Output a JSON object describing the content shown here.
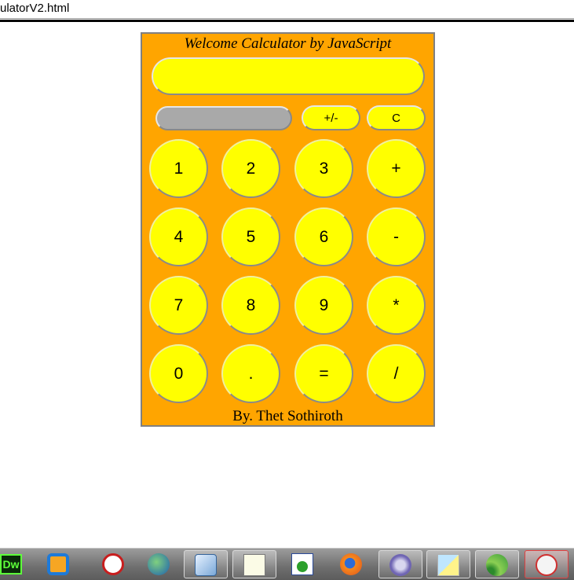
{
  "window": {
    "title": "ulatorV2.html"
  },
  "calculator": {
    "heading": "Welcome Calculator by JavaScript",
    "display_value": "",
    "memory_value": "",
    "sign_button": "+/-",
    "clear_button": "C",
    "keys": [
      [
        "1",
        "2",
        "3",
        "+"
      ],
      [
        "4",
        "5",
        "6",
        "-"
      ],
      [
        "7",
        "8",
        "9",
        "*"
      ],
      [
        "0",
        ".",
        "=",
        "/"
      ]
    ],
    "footer": "By. Thet Sothiroth"
  },
  "colors": {
    "panel": "#ffa500",
    "buttons": "#ffff00",
    "memory_field": "#a9a9a9",
    "border": "#808080"
  },
  "taskbar": {
    "items": [
      {
        "icon": "dreamweaver-icon",
        "label": "Dw"
      },
      {
        "icon": "vmware-icon"
      },
      {
        "icon": "alarm-clock-icon"
      },
      {
        "icon": "globe-rocket-icon"
      },
      {
        "icon": "virtualbox-cube-icon"
      },
      {
        "icon": "notepad-plus-plus-icon"
      },
      {
        "icon": "network-window-icon"
      },
      {
        "icon": "firefox-icon"
      },
      {
        "icon": "bittorrent-icon"
      },
      {
        "icon": "sticky-notes-icon"
      },
      {
        "icon": "feed-reader-icon"
      },
      {
        "icon": "snipping-tool-icon"
      }
    ]
  }
}
